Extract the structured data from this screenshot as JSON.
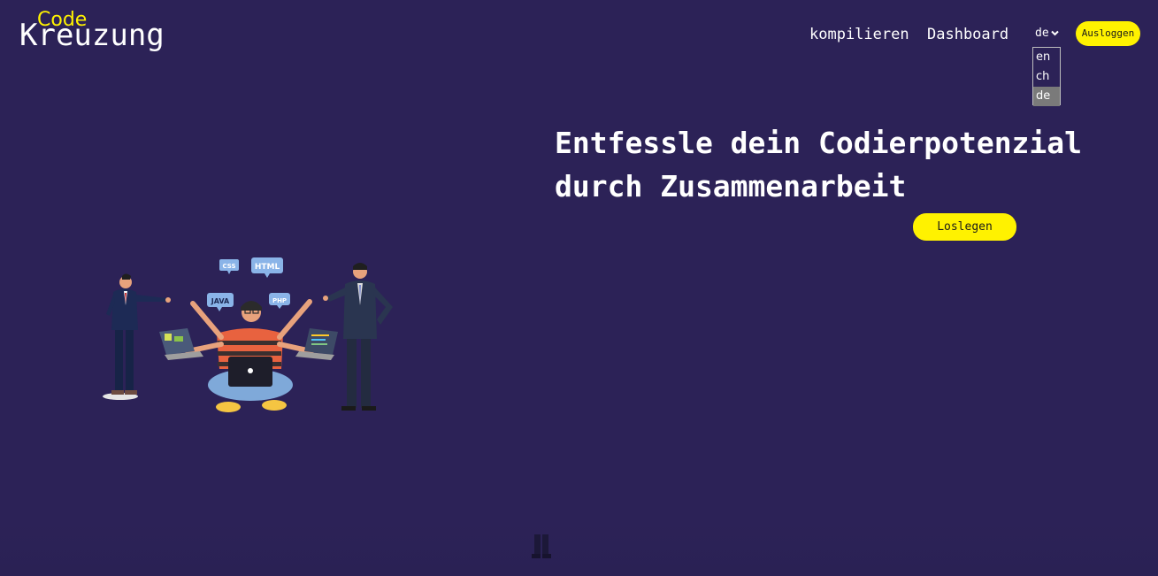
{
  "logo": {
    "small": "Code",
    "main": "Kreuzung"
  },
  "nav": {
    "compile": "kompilieren",
    "dashboard": "Dashboard"
  },
  "language": {
    "selected": "de",
    "options": [
      "en",
      "ch",
      "de"
    ]
  },
  "buttons": {
    "logout": "Ausloggen",
    "get_started": "Loslegen"
  },
  "hero": {
    "headline": "Entfessle dein Codierpotenzial durch Zusammenarbeit"
  },
  "illustration": {
    "bubbles": [
      "CSS",
      "HTML",
      "JAVA",
      "PHP"
    ]
  },
  "colors": {
    "background": "#2c2257",
    "accent": "#fff200",
    "text": "#ffffff"
  }
}
